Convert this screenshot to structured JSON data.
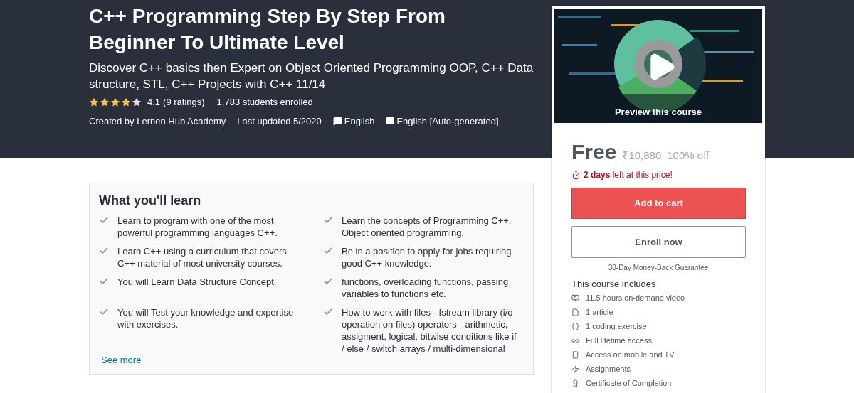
{
  "course": {
    "title": "C++ Programming Step By Step From Beginner To Ultimate Level",
    "subtitle": "Discover C++ basics then Expert on Object Oriented Programming OOP, C++ Data structure, STL, C++ Projects with C++ 11/14",
    "stars": 4,
    "rating": "4.1",
    "ratings_count": "(9 ratings)",
    "enrolled": "1,783 students enrolled",
    "created_by": "Created by Lernen Hub Academy",
    "last_updated": "Last updated 5/2020",
    "language": "English",
    "captions": "English [Auto-generated]"
  },
  "learn": {
    "heading": "What you'll learn",
    "items": [
      {
        "text": "Learn to program with one of the most powerful programming languages C++."
      },
      {
        "text": "Learn the concepts of Programming C++, Object oriented programming."
      },
      {
        "text": "Learn C++ using a curriculum that covers C++ material of most university courses."
      },
      {
        "text": "Be in a position to apply for jobs requiring good C++ knowledge."
      },
      {
        "text": "You will Learn Data Structure Concept."
      },
      {
        "text": "functions, overloading functions, passing variables to functions etc."
      },
      {
        "text": "You will Test your knowledge and expertise with exercises."
      },
      {
        "text": "How to work with files - fstream library (i/o operation on files) operators - arithmetic, assigment, logical, bitwise conditions like if / else / switch arrays / multi-dimensional"
      }
    ],
    "see_more": "See more"
  },
  "sidebar": {
    "preview_label": "Preview this course",
    "price": "Free",
    "original_price": "₹10,880",
    "discount": "100% off",
    "timer_bold": "2 days",
    "timer_rest": "left at this price!",
    "add_to_cart": "Add to cart",
    "enroll": "Enroll now",
    "guarantee": "30-Day Money-Back Guarantee",
    "includes_heading": "This course includes",
    "includes": [
      {
        "kind": "video",
        "text": "11.5 hours on-demand video"
      },
      {
        "kind": "article",
        "text": "1 article"
      },
      {
        "kind": "code",
        "text": "1 coding exercise"
      },
      {
        "kind": "lifetime",
        "text": "Full lifetime access"
      },
      {
        "kind": "mobile",
        "text": "Access on mobile and TV"
      },
      {
        "kind": "assignment",
        "text": "Assignments"
      },
      {
        "kind": "certificate",
        "text": "Certificate of Completion"
      }
    ]
  }
}
